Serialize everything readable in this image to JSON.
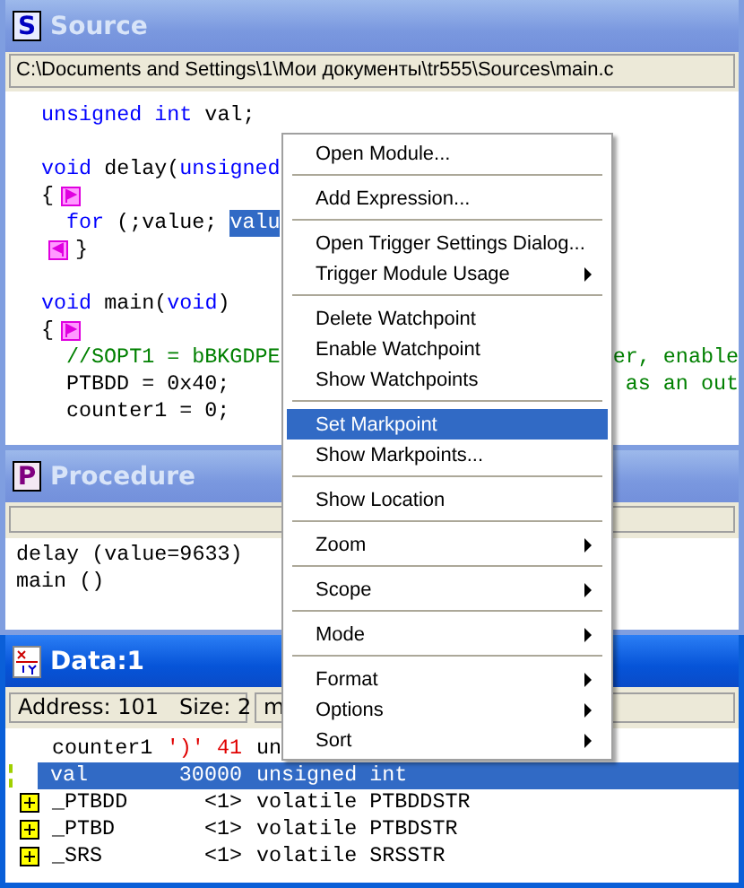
{
  "source_window": {
    "title": "Source",
    "icon_letter": "S",
    "active": false,
    "path": "C:\\Documents and Settings\\1\\Мои документы\\tr555\\Sources\\main.c",
    "lines": [
      {
        "segments": [
          {
            "kind": "keyword",
            "text": "unsigned int"
          },
          {
            "kind": "plain",
            "text": " val;"
          }
        ]
      },
      {
        "segments": [
          {
            "kind": "blank"
          }
        ]
      },
      {
        "segments": [
          {
            "kind": "keyword",
            "text": "void"
          },
          {
            "kind": "plain",
            "text": " delay("
          },
          {
            "kind": "keyword",
            "text": "unsigned"
          }
        ]
      },
      {
        "segments": [
          {
            "kind": "plain",
            "text": "{"
          },
          {
            "kind": "marker_in"
          }
        ]
      },
      {
        "segments": [
          {
            "kind": "indent"
          },
          {
            "kind": "keyword",
            "text": "for"
          },
          {
            "kind": "plain",
            "text": " (;value; "
          },
          {
            "kind": "selected",
            "text": "valu"
          }
        ]
      },
      {
        "segments": [
          {
            "kind": "marker_out"
          },
          {
            "kind": "plain",
            "text": "}"
          }
        ]
      },
      {
        "segments": [
          {
            "kind": "blank"
          }
        ]
      },
      {
        "segments": [
          {
            "kind": "keyword",
            "text": "void"
          },
          {
            "kind": "plain",
            "text": " main("
          },
          {
            "kind": "keyword",
            "text": "void"
          },
          {
            "kind": "plain",
            "text": ")"
          }
        ]
      },
      {
        "segments": [
          {
            "kind": "plain",
            "text": "{"
          },
          {
            "kind": "marker_in"
          }
        ]
      },
      {
        "segments": [
          {
            "kind": "indent"
          },
          {
            "kind": "comment",
            "text": "//SOPT1 = bBKGDPE"
          },
          {
            "kind": "comment_tail",
            "text": "er, enable"
          }
        ]
      },
      {
        "segments": [
          {
            "kind": "indent"
          },
          {
            "kind": "plain",
            "text": "PTBDD = 0x40;"
          },
          {
            "kind": "comment_tail",
            "text": "as an out"
          }
        ]
      },
      {
        "segments": [
          {
            "kind": "indent"
          },
          {
            "kind": "plain",
            "text": "counter1 = 0;"
          }
        ]
      }
    ]
  },
  "procedure_window": {
    "title": "Procedure",
    "icon_letter": "P",
    "active": false,
    "entries": [
      "delay (value=9633)",
      "main ()"
    ]
  },
  "data_window": {
    "title": "Data:1",
    "active": true,
    "address_info": "Address: 101   Size: 2",
    "field_2": "m",
    "rows": [
      {
        "expandable": false,
        "selected": false,
        "changed": false,
        "name": "counter1",
        "value": "')' 41",
        "value_highlighted": true,
        "type": "un"
      },
      {
        "expandable": false,
        "selected": true,
        "changed": true,
        "name": "val",
        "value": "30000",
        "value_highlighted": false,
        "type": "unsigned int"
      },
      {
        "expandable": true,
        "selected": false,
        "changed": false,
        "name": "_PTBDD",
        "value": "<1>",
        "value_highlighted": false,
        "type": "volatile PTBDDSTR"
      },
      {
        "expandable": true,
        "selected": false,
        "changed": false,
        "name": "_PTBD",
        "value": "<1>",
        "value_highlighted": false,
        "type": "volatile PTBDSTR"
      },
      {
        "expandable": true,
        "selected": false,
        "changed": false,
        "name": "_SRS",
        "value": "<1>",
        "value_highlighted": false,
        "type": "volatile SRSSTR"
      }
    ]
  },
  "context_menu": {
    "items": [
      {
        "kind": "item",
        "label": "Open Module...",
        "submenu": false,
        "selected": false
      },
      {
        "kind": "separator"
      },
      {
        "kind": "item",
        "label": "Add Expression...",
        "submenu": false,
        "selected": false
      },
      {
        "kind": "separator"
      },
      {
        "kind": "item",
        "label": "Open Trigger Settings Dialog...",
        "submenu": false,
        "selected": false
      },
      {
        "kind": "item",
        "label": "Trigger Module Usage",
        "submenu": true,
        "selected": false
      },
      {
        "kind": "separator"
      },
      {
        "kind": "item",
        "label": "Delete Watchpoint",
        "submenu": false,
        "selected": false
      },
      {
        "kind": "item",
        "label": "Enable Watchpoint",
        "submenu": false,
        "selected": false
      },
      {
        "kind": "item",
        "label": "Show Watchpoints",
        "submenu": false,
        "selected": false
      },
      {
        "kind": "separator"
      },
      {
        "kind": "item",
        "label": "Set Markpoint",
        "submenu": false,
        "selected": true
      },
      {
        "kind": "item",
        "label": "Show Markpoints...",
        "submenu": false,
        "selected": false
      },
      {
        "kind": "separator"
      },
      {
        "kind": "item",
        "label": "Show Location",
        "submenu": false,
        "selected": false
      },
      {
        "kind": "separator"
      },
      {
        "kind": "item",
        "label": "Zoom",
        "submenu": true,
        "selected": false
      },
      {
        "kind": "separator"
      },
      {
        "kind": "item",
        "label": "Scope",
        "submenu": true,
        "selected": false
      },
      {
        "kind": "separator"
      },
      {
        "kind": "item",
        "label": "Mode",
        "submenu": true,
        "selected": false
      },
      {
        "kind": "separator"
      },
      {
        "kind": "item",
        "label": "Format",
        "submenu": true,
        "selected": false
      },
      {
        "kind": "item",
        "label": "Options",
        "submenu": true,
        "selected": false
      },
      {
        "kind": "item",
        "label": "Sort",
        "submenu": true,
        "selected": false
      }
    ]
  }
}
